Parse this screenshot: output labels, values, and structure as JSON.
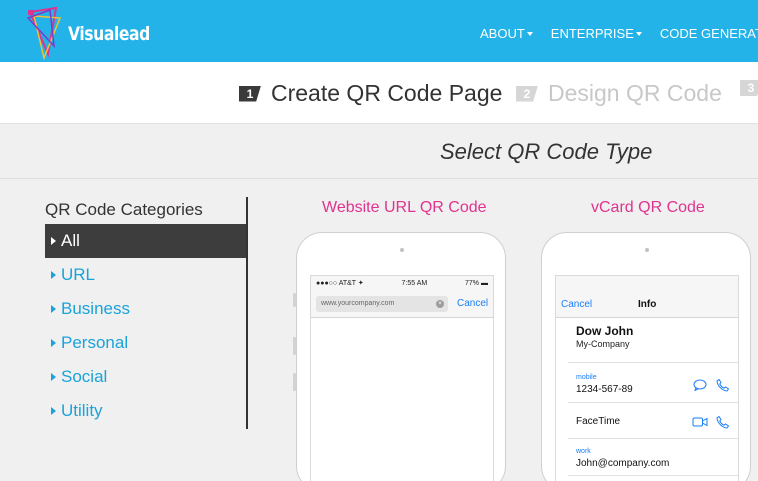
{
  "header": {
    "logo_text": "Visualead",
    "nav": [
      "ABOUT",
      "ENTERPRISE",
      "CODE GENERATOR"
    ],
    "colors": {
      "bar": "#23b3e8"
    }
  },
  "steps": [
    {
      "num": "1",
      "label": "Create QR Code Page",
      "active": true
    },
    {
      "num": "2",
      "label": "Design QR Code",
      "active": false
    },
    {
      "num": "3",
      "label": "",
      "active": false
    }
  ],
  "main": {
    "title": "Select QR Code Type"
  },
  "categories": {
    "title": "QR Code Categories",
    "items": [
      "All",
      "URL",
      "Business",
      "Personal",
      "Social",
      "Utility"
    ],
    "selected": "All"
  },
  "cards": {
    "website": {
      "title": "Website URL QR Code",
      "status_carrier": "●●●○○ AT&T ✦",
      "status_time": "7:55 AM",
      "status_battery": "77% ▬",
      "url": "www.yourcompany.com",
      "cancel": "Cancel"
    },
    "vcard": {
      "title": "vCard QR Code",
      "cancel": "Cancel",
      "info": "Info",
      "name": "Dow John",
      "company": "My-Company",
      "mobile_label": "mobile",
      "mobile": "1234-567-89",
      "facetime": "FaceTime",
      "work_label": "work",
      "email": "John@company.com"
    }
  },
  "icons": [
    "logo-mark-icon",
    "caret-down-icon",
    "chevron-right-icon",
    "clear-icon",
    "message-icon",
    "phone-icon",
    "video-icon"
  ]
}
